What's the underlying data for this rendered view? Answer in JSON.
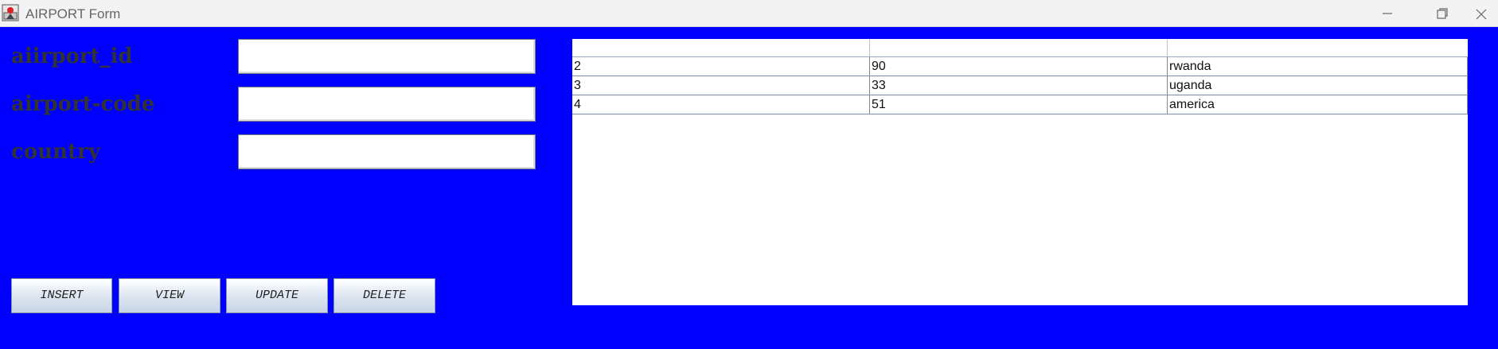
{
  "window": {
    "title": "AIRPORT Form"
  },
  "form": {
    "fields": [
      {
        "label": "aiirport_id",
        "value": ""
      },
      {
        "label": "airport-code",
        "value": ""
      },
      {
        "label": "country",
        "value": ""
      }
    ],
    "buttons": [
      "INSERT",
      "VIEW",
      "UPDATE",
      "DELETE"
    ]
  },
  "table": {
    "columns": [
      "",
      "",
      ""
    ],
    "rows": [
      [
        "2",
        "90",
        "rwanda"
      ],
      [
        "3",
        "33",
        "uganda"
      ],
      [
        "4",
        "51",
        "america"
      ]
    ]
  },
  "colors": {
    "background": "#0000ff",
    "label_text": "#333333"
  },
  "icons": {
    "app": "java-app-icon",
    "minimize": "minimize-icon",
    "restore": "restore-icon",
    "close": "close-icon"
  }
}
